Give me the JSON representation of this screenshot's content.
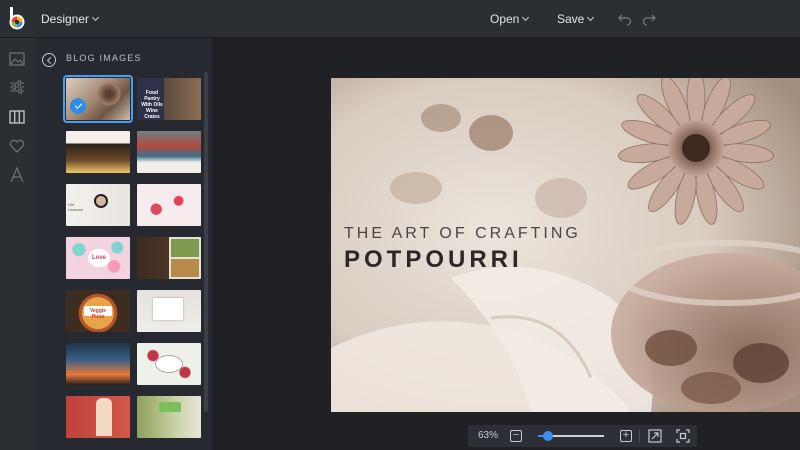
{
  "topbar": {
    "mode_label": "Designer",
    "open_label": "Open",
    "save_label": "Save"
  },
  "iconbar": {
    "items": [
      "image-icon",
      "sliders-icon",
      "layout-columns-icon",
      "heart-icon",
      "text-icon"
    ],
    "active": "layout-columns-icon"
  },
  "panel": {
    "title": "BLOG IMAGES",
    "thumbnails": [
      {
        "label": "",
        "selected": true
      },
      {
        "label": "Food Pantry With Oils Wine Crates",
        "selected": false
      },
      {
        "label": "",
        "selected": false
      },
      {
        "label": "",
        "selected": false
      },
      {
        "label": "Life Lessons",
        "selected": false
      },
      {
        "label": "",
        "selected": false
      },
      {
        "label": "Love",
        "selected": false
      },
      {
        "label": "",
        "selected": false
      },
      {
        "label": "Veggie Pizza",
        "selected": false
      },
      {
        "label": "",
        "selected": false
      },
      {
        "label": "",
        "selected": false
      },
      {
        "label": "",
        "selected": false
      },
      {
        "label": "",
        "selected": false
      },
      {
        "label": "",
        "selected": false
      }
    ]
  },
  "canvas": {
    "headline_top": "THE ART OF CRAFTING",
    "headline_main": "POTPOURRI"
  },
  "zoom": {
    "value_label": "63%",
    "level": 0.15
  },
  "colors": {
    "accent": "#3b8eea",
    "topbar": "#2b2e33",
    "panel": "#262a30",
    "stage": "#1f2125"
  }
}
